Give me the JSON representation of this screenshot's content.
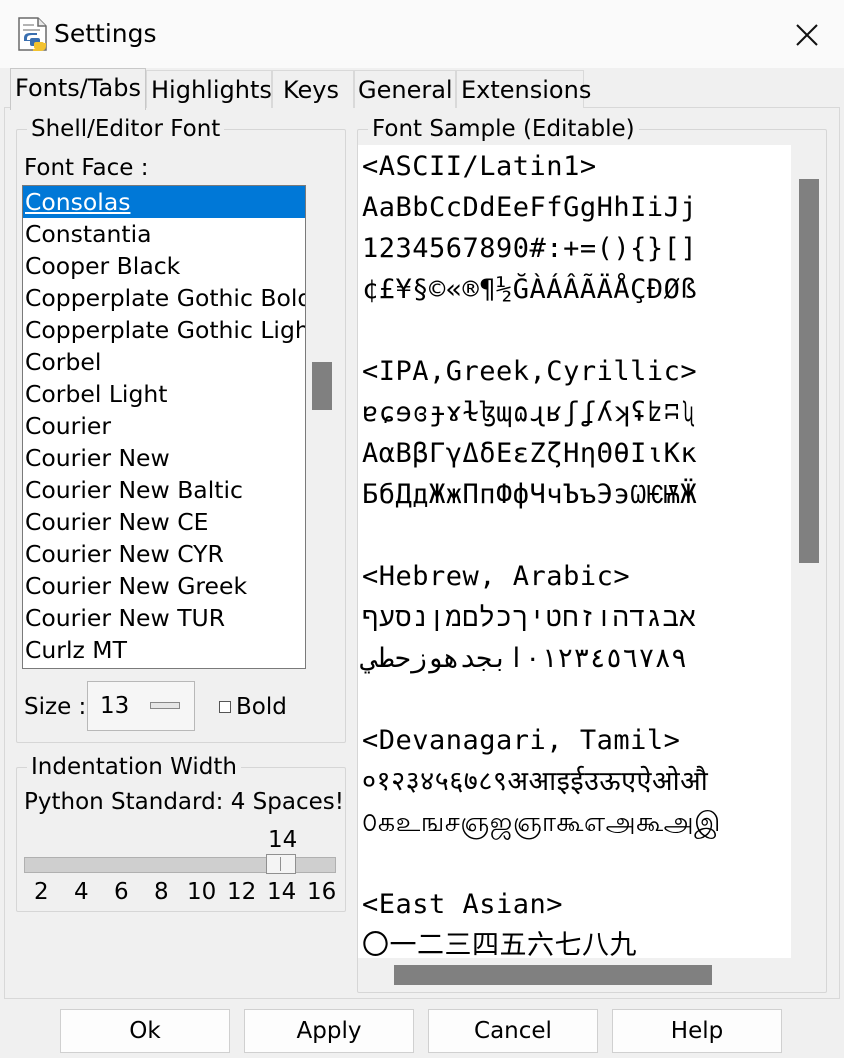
{
  "window": {
    "title": "Settings",
    "icon": "python-idle-icon",
    "close_icon": "close-icon"
  },
  "tabs": [
    {
      "label": "Fonts/Tabs",
      "active": true
    },
    {
      "label": "Highlights",
      "active": false
    },
    {
      "label": "Keys",
      "active": false
    },
    {
      "label": "General",
      "active": false
    },
    {
      "label": "Extensions",
      "active": false
    }
  ],
  "font_group": {
    "legend": "Shell/Editor Font",
    "face_label": "Font Face :",
    "fonts": [
      "Consolas",
      "Constantia",
      "Cooper Black",
      "Copperplate Gothic Bold",
      "Copperplate Gothic Light",
      "Corbel",
      "Corbel Light",
      "Courier",
      "Courier New",
      "Courier New Baltic",
      "Courier New CE",
      "Courier New CYR",
      "Courier New Greek",
      "Courier New TUR",
      "Curlz MT"
    ],
    "selected": "Consolas",
    "size_label": "Size :",
    "size_value": "13",
    "bold_label": "Bold",
    "bold_checked": false
  },
  "indent_group": {
    "legend": "Indentation Width",
    "standard_text": "Python Standard: 4 Spaces!",
    "value_label": "14",
    "slider_fraction": 0.857,
    "ticks": [
      "2",
      "4",
      "6",
      "8",
      "10",
      "12",
      "14",
      "16"
    ]
  },
  "sample_group": {
    "legend": "Font Sample (Editable)",
    "lines": [
      "<ASCII/Latin1>",
      "AaBbCcDdEeFfGgHhIiJj",
      "1234567890#:+=(){}[]",
      "¢£¥§©«®¶½ĞÀÁÂÃÄÅÇÐØß",
      "",
      "<IPA,Greek,Cyrillic>",
      "ɐɕɘɞɟɤɫɮɰɷɻʁʃʆʎʞʢʫʭʯ",
      "ΑαΒβΓγΔδΕεΖζΗηΘθΙιΚκ",
      "БбДдЖжПпФфЧчЪъЭэѠѤѬӜ",
      "",
      "<Hebrew, Arabic>",
      "אבגדהוזחטיךכלםמןנסעף",
      "٠١٢٣٤٥٦٧٨٩ابجدهوزحطي",
      "",
      "<Devanagari, Tamil>",
      "०१२३४५६७८९अआइईउऊएऐओऔ",
      "௦கஉஙசஞஜஞாகூஎஅகூஅஇ",
      "",
      "<East Asian>",
      "〇一二三四五六七八九"
    ]
  },
  "buttons": {
    "ok": "Ok",
    "apply": "Apply",
    "cancel": "Cancel",
    "help": "Help"
  }
}
